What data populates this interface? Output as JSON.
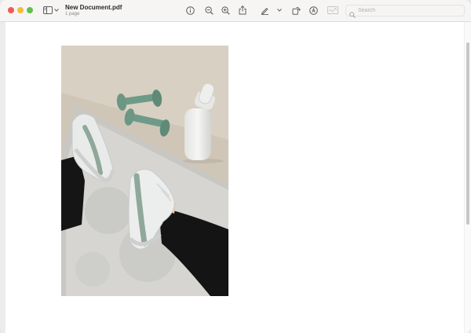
{
  "window": {
    "title": "New Document.pdf",
    "subtitle": "1 page"
  },
  "toolbar": {
    "icons": [
      "sidebar-icon",
      "chevron-down-icon",
      "info-icon",
      "zoom-out-icon",
      "zoom-in-icon",
      "share-icon",
      "markup-pen-icon",
      "chevron-down-icon",
      "rotate-icon",
      "annotate-icon",
      "signature-icon",
      "search-icon"
    ]
  },
  "search": {
    "placeholder": "Search",
    "value": ""
  },
  "colors": {
    "toolbar_bg": "#f6f5f4",
    "close": "#ee5b57",
    "minimize": "#f3bc3a",
    "zoom": "#5fc24c",
    "icon": "#5e5e5e"
  },
  "document": {
    "pages": [
      {
        "content": "photo of sneakers, dumbbells and water bottle on a rug"
      }
    ]
  }
}
